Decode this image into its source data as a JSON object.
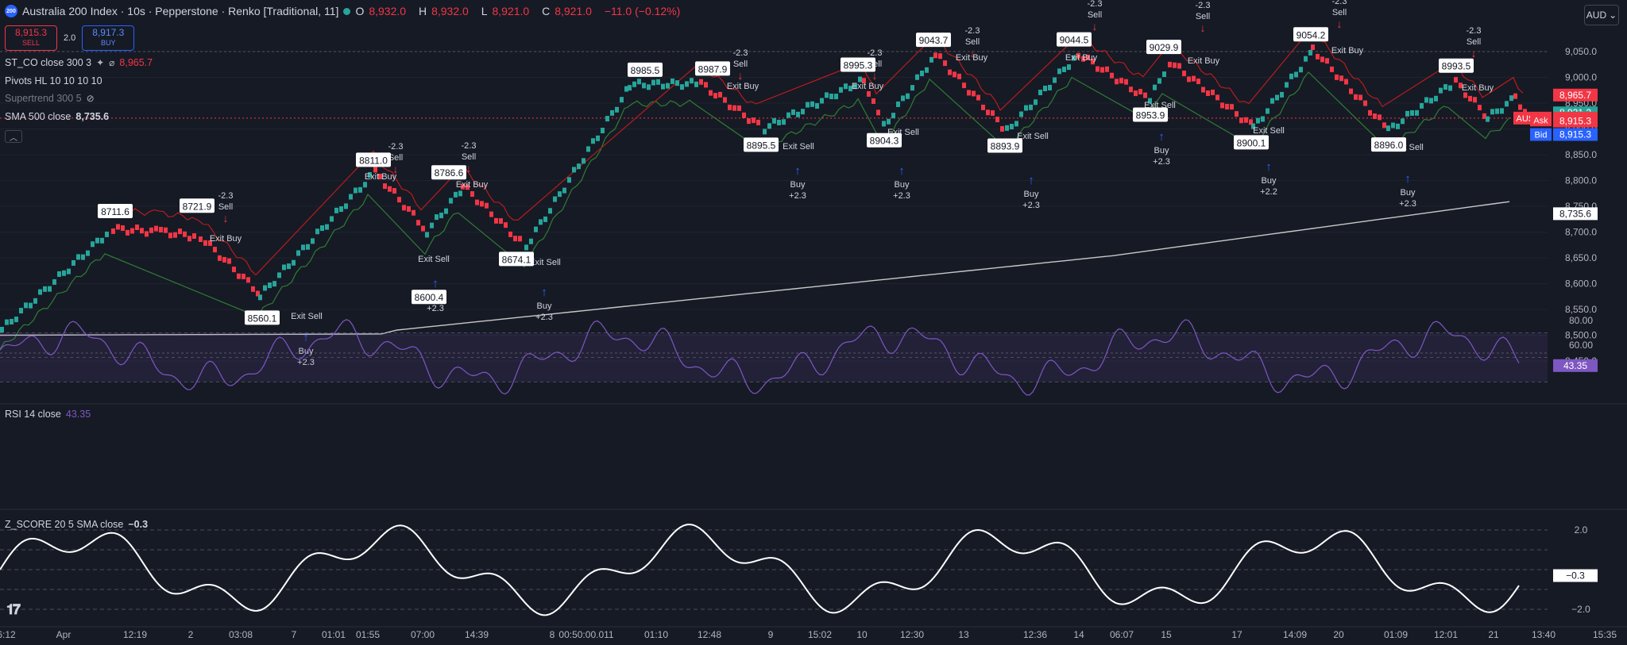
{
  "header": {
    "logo_text": "200",
    "title": "Australia 200 Index · 10s · Pepperstone · Renko [Traditional, 11]",
    "ohlc": {
      "o_label": "O",
      "o": "8,932.0",
      "h_label": "H",
      "h": "8,932.0",
      "l_label": "L",
      "l": "8,921.0",
      "c_label": "C",
      "c": "8,921.0",
      "change": "−11.0 (−0.12%)"
    }
  },
  "trade": {
    "sell_price": "8,915.3",
    "sell_label": "SELL",
    "spread": "2.0",
    "buy_price": "8,917.3",
    "buy_label": "BUY"
  },
  "indicators": [
    {
      "name": "ST_CO close 300 3",
      "symbol": "⌀",
      "value": "8,965.7"
    },
    {
      "name": "Pivots HL 10 10 10 10",
      "value": ""
    },
    {
      "name": "Supertrend 300 5",
      "value": ""
    },
    {
      "name": "SMA 500 close",
      "value": "8,735.6"
    }
  ],
  "currency": "AUD",
  "colors": {
    "bg": "#161a25",
    "up": "#26a69a",
    "down": "#f23645",
    "sma": "#c8c8c8",
    "rsi": "#7e57c2",
    "zscore": "#ffffff",
    "buy": "#2962ff",
    "exit": "#e040fb"
  },
  "price_axis": {
    "ticks": [
      "9,050.0",
      "9,000.0",
      "8,950.0",
      "8,900.0",
      "8,850.0",
      "8,800.0",
      "8,750.0",
      "8,700.0",
      "8,650.0",
      "8,600.0",
      "8,550.0",
      "8,500.0",
      "8,450.0"
    ]
  },
  "price_badges": [
    {
      "text": "8,965.7",
      "color": "#f23645"
    },
    {
      "text": "8,931.2",
      "color": "#26a69a"
    },
    {
      "text": "8,921.0",
      "color": "#f23645",
      "tag": "AUS200"
    },
    {
      "text": "8,917.3",
      "color": "#f23645",
      "tag": "Ask"
    },
    {
      "text": "8,915.3",
      "color": "#f23645"
    },
    {
      "text": "8,915.3",
      "color": "#2962ff",
      "tag": "Bid"
    },
    {
      "text": "8,735.6",
      "color": "#ffffff"
    }
  ],
  "time_axis": [
    "6:12",
    "Apr",
    "12:19",
    "2",
    "03:08",
    "7",
    "01:01",
    "01:55",
    "07:00",
    "14:39",
    "8",
    "00:50:00.011",
    "01:10",
    "12:48",
    "9",
    "15:02",
    "10",
    "12:30",
    "13",
    "12:36",
    "14",
    "06:07",
    "15",
    "17",
    "14:09",
    "20",
    "01:09",
    "12:01",
    "21",
    "13:40",
    "15:35"
  ],
  "pivots_high": [
    "8711.6",
    "8721.9",
    "8811.0",
    "8786.6",
    "8985.5",
    "8987.9",
    "8995.3",
    "9043.7",
    "9044.5",
    "9029.9",
    "9054.2",
    "8993.5"
  ],
  "pivots_low": [
    "8560.1",
    "8600.4",
    "8674.1",
    "8895.5",
    "8904.3",
    "8893.9",
    "8953.9",
    "8900.1",
    "8896.0"
  ],
  "signals": {
    "sell_label": "Sell",
    "sell_amt": "-2.3",
    "buy_label": "Buy",
    "buy_amt": "+2.3",
    "buy_amt_alt": "+2.2",
    "exit_buy": "Exit Buy",
    "exit_sell": "Exit Sell"
  },
  "rsi": {
    "title": "RSI 14 close",
    "value": "43.35",
    "ticks": [
      "80.00",
      "60.00"
    ]
  },
  "zscore": {
    "title": "Z_SCORE 20 5 SMA close",
    "value": "−0.3",
    "ticks": [
      "2.0",
      "−2.0"
    ]
  }
}
